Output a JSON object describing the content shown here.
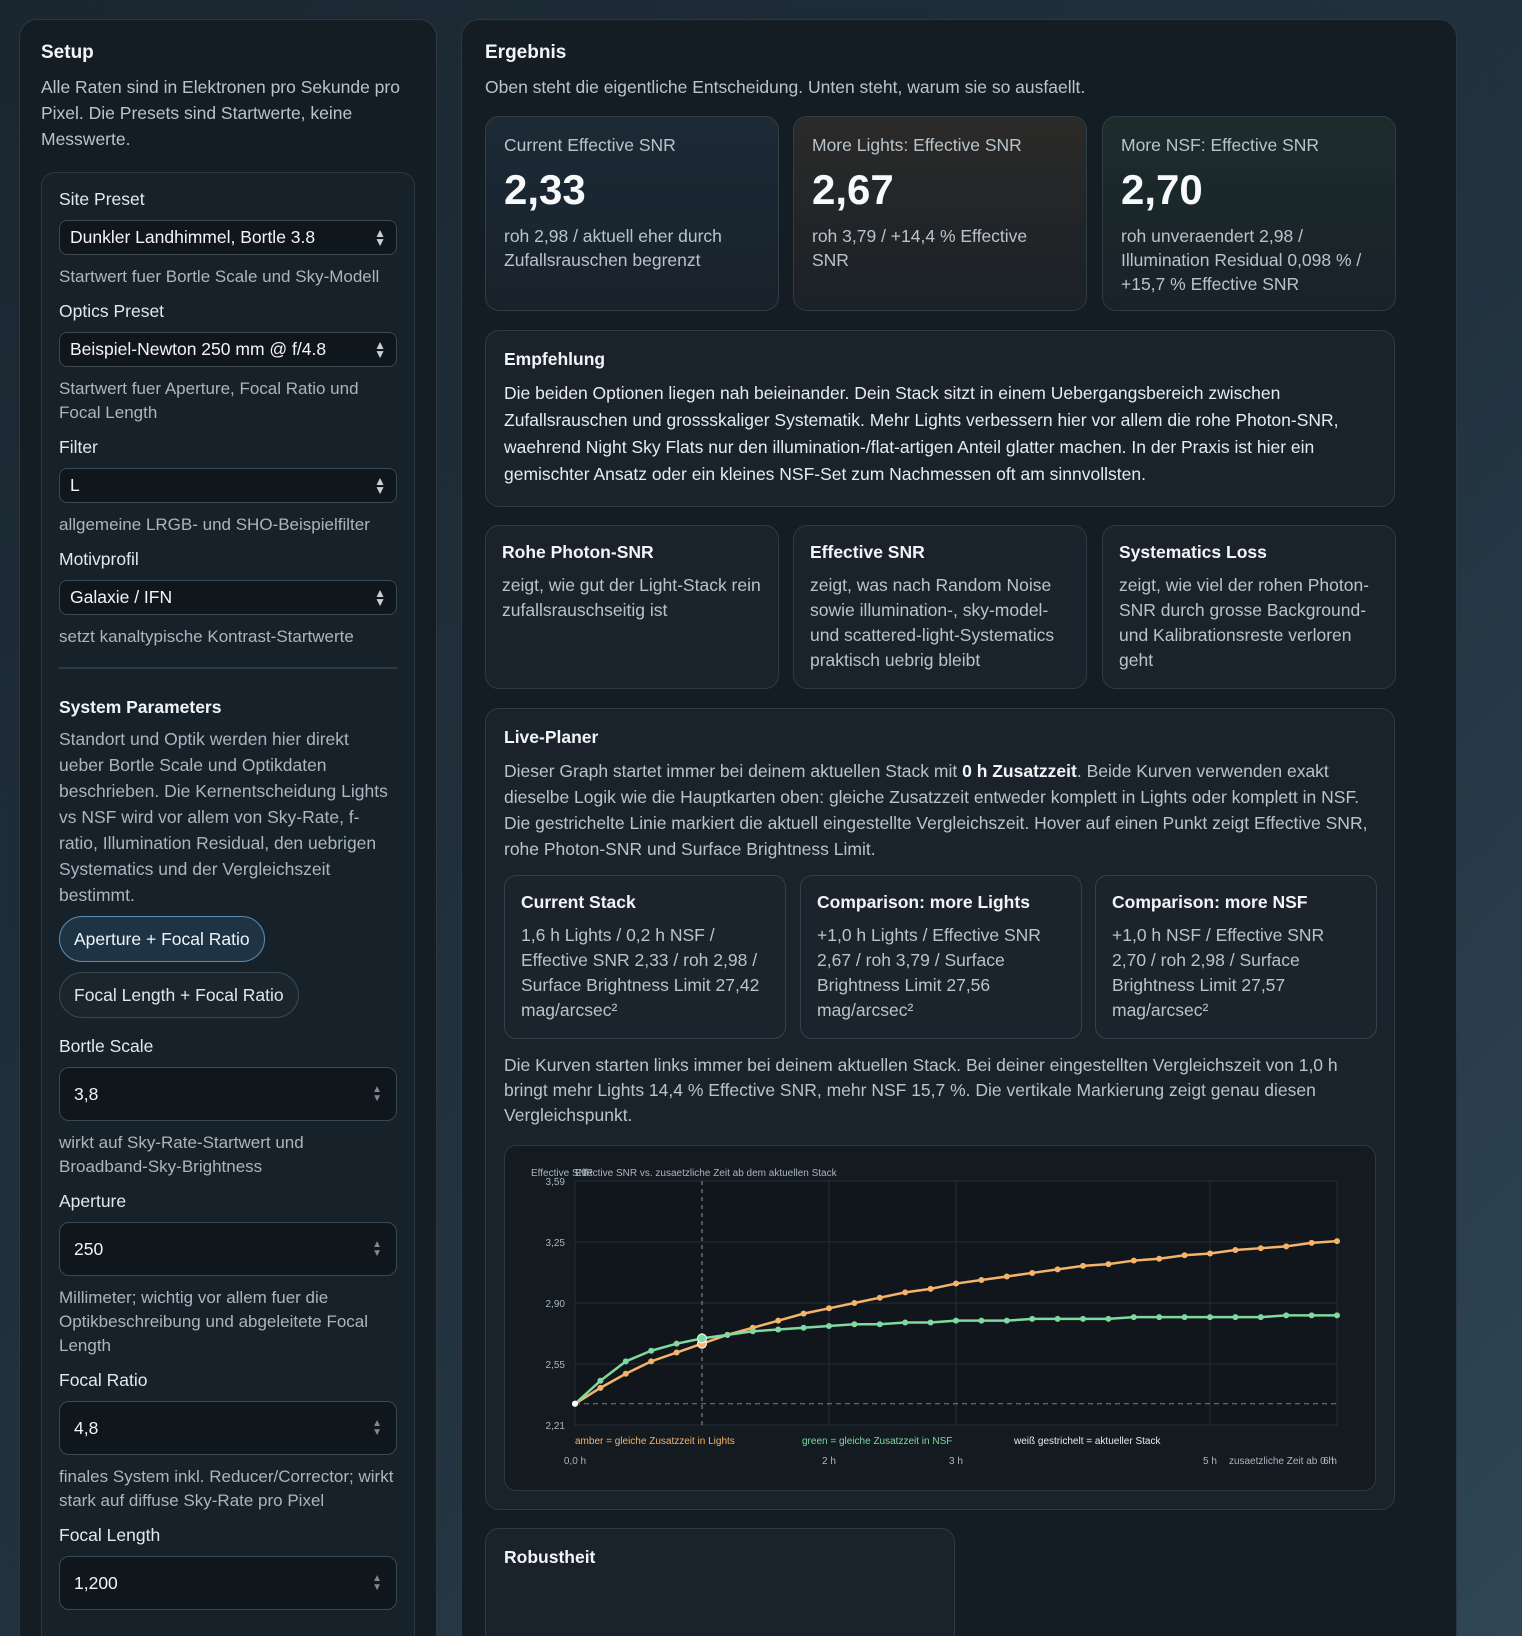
{
  "setup": {
    "title": "Setup",
    "description": "Alle Raten sind in Elektronen pro Sekunde pro Pixel. Die Presets sind Startwerte, keine Messwerte.",
    "site_preset": {
      "label": "Site Preset",
      "value": "Dunkler Landhimmel, Bortle 3.8",
      "help": "Startwert fuer Bortle Scale und Sky-Modell"
    },
    "optics_preset": {
      "label": "Optics Preset",
      "value": "Beispiel-Newton 250 mm @ f/4.8",
      "help": "Startwert fuer Aperture, Focal Ratio und Focal Length"
    },
    "filter": {
      "label": "Filter",
      "value": "L",
      "help": "allgemeine LRGB- und SHO-Beispielfilter"
    },
    "motif": {
      "label": "Motivprofil",
      "value": "Galaxie / IFN",
      "help": "setzt kanaltypische Kontrast-Startwerte"
    },
    "system": {
      "title": "System Parameters",
      "description": "Standort und Optik werden hier direkt ueber Bortle Scale und Optikdaten beschrieben. Die Kernentscheidung Lights vs NSF wird vor allem von Sky-Rate, f-ratio, Illumination Residual, den uebrigen Systematics und der Vergleichszeit bestimmt.",
      "mode_a": "Aperture + Focal Ratio",
      "mode_b": "Focal Length + Focal Ratio"
    },
    "bortle": {
      "label": "Bortle Scale",
      "value": "3,8",
      "help": "wirkt auf Sky-Rate-Startwert und Broadband-Sky-Brightness"
    },
    "aperture": {
      "label": "Aperture",
      "value": "250",
      "help": "Millimeter; wichtig vor allem fuer die Optikbeschreibung und abgeleitete Focal Length"
    },
    "focal_ratio": {
      "label": "Focal Ratio",
      "value": "4,8",
      "help": "finales System inkl. Reducer/Corrector; wirkt stark auf diffuse Sky-Rate pro Pixel"
    },
    "focal_length": {
      "label": "Focal Length",
      "value": "1,200"
    }
  },
  "result": {
    "title": "Ergebnis",
    "description": "Oben steht die eigentliche Entscheidung. Unten steht, warum sie so ausfaellt.",
    "metrics": [
      {
        "label": "Current Effective SNR",
        "value": "2,33",
        "sub": "roh 2,98 / aktuell eher durch Zufallsrauschen begrenzt"
      },
      {
        "label": "More Lights: Effective SNR",
        "value": "2,67",
        "sub": "roh 3,79 / +14,4 % Effective SNR"
      },
      {
        "label": "More NSF: Effective SNR",
        "value": "2,70",
        "sub": "roh unveraendert 2,98 / Illumination Residual 0,098 % / +15,7 % Effective SNR"
      }
    ],
    "recommendation": {
      "title": "Empfehlung",
      "text": "Die beiden Optionen liegen nah beieinander. Dein Stack sitzt in einem Uebergangsbereich zwischen Zufallsrauschen und grossskaliger Systematik. Mehr Lights verbessern hier vor allem die rohe Photon-SNR, waehrend Night Sky Flats nur den illumination-/flat-artigen Anteil glatter machen. In der Praxis ist hier ein gemischter Ansatz oder ein kleines NSF-Set zum Nachmessen oft am sinnvollsten."
    },
    "explainers": [
      {
        "title": "Rohe Photon-SNR",
        "text": "zeigt, wie gut der Light-Stack rein zufallsrauschseitig ist"
      },
      {
        "title": "Effective SNR",
        "text": "zeigt, was nach Random Noise sowie illumination-, sky-model- und scattered-light-Systematics praktisch uebrig bleibt"
      },
      {
        "title": "Systematics Loss",
        "text": "zeigt, wie viel der rohen Photon-SNR durch grosse Background- und Kalibrationsreste verloren geht"
      }
    ],
    "planner": {
      "title": "Live-Planer",
      "intro_pre": "Dieser Graph startet immer bei deinem aktuellen Stack mit ",
      "intro_bold": "0 h Zusatzzeit",
      "intro_post": ". Beide Kurven verwenden exakt dieselbe Logik wie die Hauptkarten oben: gleiche Zusatzzeit entweder komplett in Lights oder komplett in NSF. Die gestrichelte Linie markiert die aktuell eingestellte Vergleichszeit. Hover auf einen Punkt zeigt Effective SNR, rohe Photon-SNR und Surface Brightness Limit.",
      "cards": [
        {
          "title": "Current Stack",
          "text": "1,6 h Lights / 0,2 h NSF / Effective SNR 2,33 / roh 2,98 / Surface Brightness Limit 27,42 mag/arcsec²"
        },
        {
          "title": "Comparison: more Lights",
          "text": "+1,0 h Lights / Effective SNR 2,67 / roh 3,79 / Surface Brightness Limit 27,56 mag/arcsec²"
        },
        {
          "title": "Comparison: more NSF",
          "text": "+1,0 h NSF / Effective SNR 2,70 / roh 2,98 / Surface Brightness Limit 27,57 mag/arcsec²"
        }
      ],
      "summary": "Die Kurven starten links immer bei deinem aktuellen Stack. Bei deiner eingestellten Vergleichszeit von 1,0 h bringt mehr Lights 14,4 % Effective SNR, mehr NSF 15,7 %. Die vertikale Markierung zeigt genau diesen Vergleichspunkt."
    },
    "robustness": {
      "title": "Robustheit"
    }
  },
  "chart_data": {
    "type": "line",
    "title": "Effective SNR vs. zusaetzliche Zeit ab dem aktuellen Stack",
    "ylabel": "Effective SNR",
    "xlabel": "zusaetzliche Zeit ab 0 h",
    "ylim": [
      2.21,
      3.59
    ],
    "xlim": [
      0,
      6
    ],
    "yticks": [
      "3,59",
      "3,25",
      "2,90",
      "2,55",
      "2,21"
    ],
    "xticks": [
      {
        "v": 0,
        "label": "0,0 h"
      },
      {
        "v": 2,
        "label": "2 h"
      },
      {
        "v": 3,
        "label": "3 h"
      },
      {
        "v": 5,
        "label": "5 h"
      },
      {
        "v": 6,
        "label": "6 h"
      }
    ],
    "current_value": 2.33,
    "comparison_x": 1.0,
    "legend": [
      "amber = gleiche Zusatzzeit in Lights",
      "green = gleiche Zusatzzeit in NSF",
      "weiß gestrichelt = aktueller Stack"
    ],
    "colors": {
      "lights": "#f5b46a",
      "nsf": "#7fd9a0",
      "current": "#d0d6db"
    },
    "x": [
      0,
      0.2,
      0.4,
      0.6,
      0.8,
      1.0,
      1.2,
      1.4,
      1.6,
      1.8,
      2.0,
      2.2,
      2.4,
      2.6,
      2.8,
      3.0,
      3.2,
      3.4,
      3.6,
      3.8,
      4.0,
      4.2,
      4.4,
      4.6,
      4.8,
      5.0,
      5.2,
      5.4,
      5.6,
      5.8,
      6.0
    ],
    "series": [
      {
        "name": "amber = gleiche Zusatzzeit in Lights",
        "key": "lights",
        "values": [
          2.33,
          2.42,
          2.5,
          2.57,
          2.62,
          2.67,
          2.72,
          2.76,
          2.8,
          2.84,
          2.87,
          2.9,
          2.93,
          2.96,
          2.98,
          3.01,
          3.03,
          3.05,
          3.07,
          3.09,
          3.11,
          3.12,
          3.14,
          3.15,
          3.17,
          3.18,
          3.2,
          3.21,
          3.22,
          3.24,
          3.25
        ]
      },
      {
        "name": "green = gleiche Zusatzzeit in NSF",
        "key": "nsf",
        "values": [
          2.33,
          2.46,
          2.57,
          2.63,
          2.67,
          2.7,
          2.72,
          2.74,
          2.75,
          2.76,
          2.77,
          2.78,
          2.78,
          2.79,
          2.79,
          2.8,
          2.8,
          2.8,
          2.81,
          2.81,
          2.81,
          2.81,
          2.82,
          2.82,
          2.82,
          2.82,
          2.82,
          2.82,
          2.83,
          2.83,
          2.83
        ]
      }
    ]
  }
}
